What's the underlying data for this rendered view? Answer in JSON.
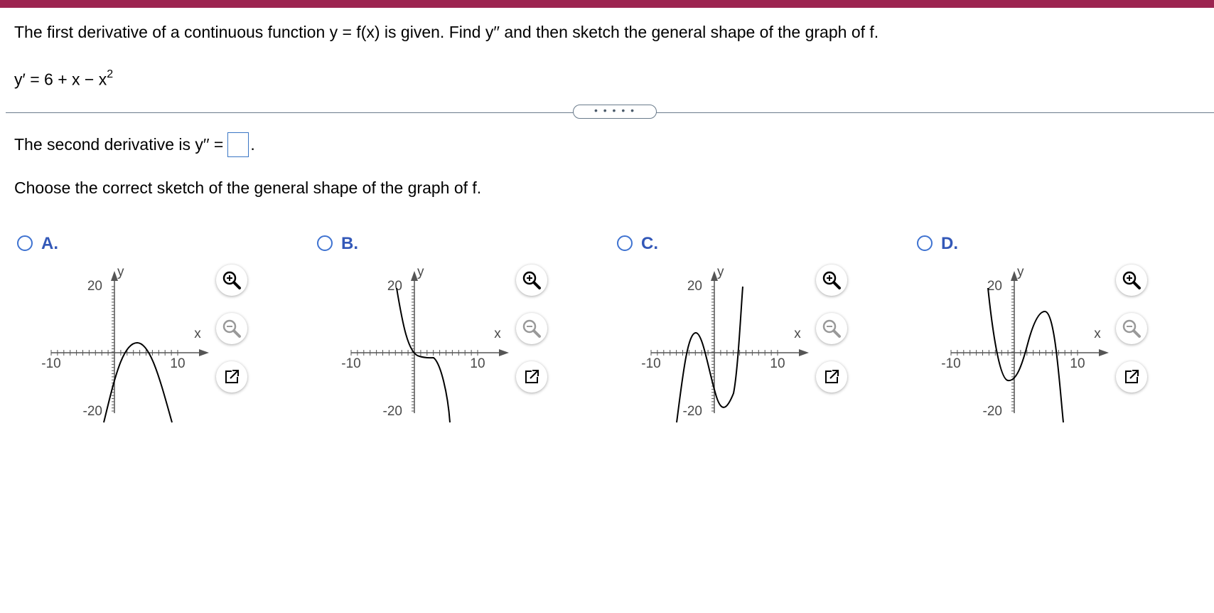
{
  "question": {
    "prompt": "The first derivative of a continuous function y = f(x) is given. Find y′′ and then sketch the general shape of the graph of f.",
    "given": "y′ = 6 + x − x",
    "given_exponent": "2",
    "expander": "• • • • •",
    "second_derivative_prefix": "The second derivative is y′′ =",
    "second_derivative_suffix": ".",
    "answer_value": "",
    "choose_prompt": "Choose the correct sketch of the general shape of the graph of f."
  },
  "options": [
    {
      "label": "A.",
      "y_axis": "y",
      "x_axis": "x",
      "x_min_label": "-10",
      "x_max_label": "10",
      "y_max_label": "20",
      "y_min_label": "-20"
    },
    {
      "label": "B.",
      "y_axis": "y",
      "x_axis": "x",
      "x_min_label": "-10",
      "x_max_label": "10",
      "y_max_label": "20",
      "y_min_label": "-20"
    },
    {
      "label": "C.",
      "y_axis": "y",
      "x_axis": "x",
      "x_min_label": "-10",
      "x_max_label": "10",
      "y_max_label": "20",
      "y_min_label": "-20"
    },
    {
      "label": "D.",
      "y_axis": "y",
      "x_axis": "x",
      "x_min_label": "-10",
      "x_max_label": "10",
      "y_max_label": "20",
      "y_min_label": "-20"
    }
  ],
  "tool_icons": [
    "zoom-in-icon",
    "zoom-out-icon",
    "popout-icon"
  ],
  "colors": {
    "header_bar": "#9c2450",
    "radio": "#3f73d1",
    "option_label": "#3358b8",
    "answer_box": "#3a76c4"
  }
}
